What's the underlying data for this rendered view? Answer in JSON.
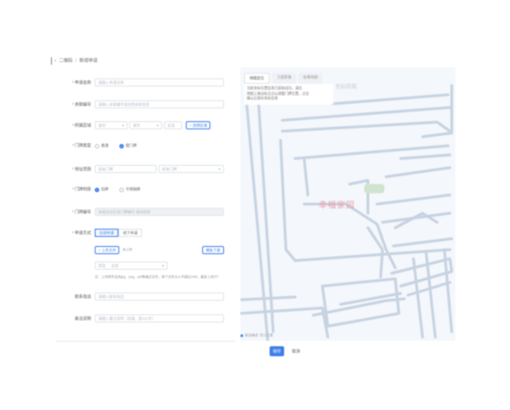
{
  "breadcrumb": {
    "parent": "二维码",
    "current": "新增申请"
  },
  "form": {
    "field1": {
      "label": "申请名称",
      "placeholder": "请输入申请名称",
      "required": true
    },
    "field2": {
      "label": "关联编号",
      "placeholder": "请输入关联编号或选择关联信息",
      "required": true
    },
    "field3": {
      "label": "所属区域",
      "required": true,
      "select1": "省份",
      "select2": "城市",
      "select3": "区县",
      "button": "+ 选择区域"
    },
    "field4": {
      "label": "门牌类型",
      "required": true,
      "options": [
        "普通",
        "楼门牌"
      ],
      "selected": 1
    },
    "field5": {
      "label": "地址范围",
      "required": true,
      "select_from": "起始门牌",
      "select_to": "结束门牌"
    },
    "field6": {
      "label": "门牌材质",
      "required": true,
      "options": [
        "铝牌",
        "不锈钢牌"
      ],
      "selected": 0
    },
    "field7": {
      "label": "门牌编号",
      "required": true,
      "placeholder": "系统自动生成门牌编号 请勿修改"
    },
    "field8": {
      "label": "申请方式",
      "required": true,
      "tabs": [
        "在线申请",
        "线下申请"
      ],
      "active_tab": 0,
      "upload_button": "+ 上传文件",
      "upload_note": "未上传",
      "download_button": "模板下载",
      "sub_select_label": "类型",
      "sub_select_value": "全部",
      "note": "注：上传附件支持jpg、png、pdf等格式文件，单个文件大小不超过10M，最多上传5个"
    },
    "field9": {
      "label": "联系电话",
      "placeholder": "请输入联系电话"
    },
    "field10": {
      "label": "备注说明",
      "placeholder": "请输入备注说明（选填，限200字）"
    }
  },
  "map": {
    "tabs": [
      "地图定位",
      "卫星影像",
      "街景地图"
    ],
    "active_tab": 0,
    "info_line1": "当前坐标位置信息已获取成功，请在",
    "info_line2": "地图上拖动标注点以调整门牌位置，点击",
    "info_line3": "确认后保存坐标信息",
    "coord_label": "坐标拾取",
    "place_label": "幸福家园",
    "footer_label": "标注地点",
    "footer_value": "默认位置"
  },
  "actions": {
    "primary": "保存",
    "secondary": "取消"
  },
  "colors": {
    "accent": "#3f7fe8",
    "road": "#c7d3e2",
    "map_bg": "#f4f7fb",
    "place_label": "#e8a0a6",
    "landmark": "#cfe3cf"
  }
}
